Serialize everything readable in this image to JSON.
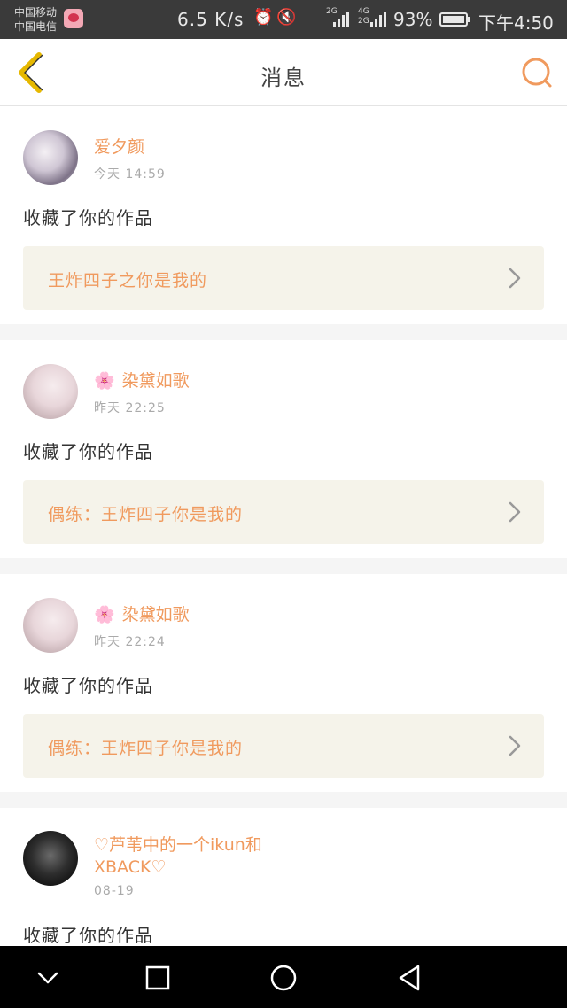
{
  "status_bar": {
    "carrier_1": "中国移动",
    "carrier_2": "中国电信",
    "net_speed": "6.5 K/s",
    "net_label_a1": "2G",
    "net_label_b1": "4G",
    "net_label_b2": "2G",
    "battery": "93%",
    "time": "下午4:50",
    "icons": [
      "alarm-icon",
      "mute-icon",
      "wifi-icon",
      "signal-icon",
      "battery-icon"
    ]
  },
  "header": {
    "title": "消息",
    "back_icon": "chevron-left-icon",
    "search_icon": "search-icon"
  },
  "messages": [
    {
      "user": "爱夕颜",
      "flower": "",
      "time": "今天  14:59",
      "action": "收藏了你的作品",
      "work": "王炸四子之你是我的"
    },
    {
      "user": "染黛如歌",
      "flower": "🌸",
      "time": "昨天  22:25",
      "action": "收藏了你的作品",
      "work": "偶练：王炸四子你是我的"
    },
    {
      "user": "染黛如歌",
      "flower": "🌸",
      "time": "昨天  22:24",
      "action": "收藏了你的作品",
      "work": "偶练：王炸四子你是我的"
    },
    {
      "user": "♡芦苇中的一个ikun和XBACK♡",
      "flower": "",
      "time": "08-19",
      "action": "收藏了你的作品",
      "work": ""
    }
  ],
  "nav_bar": {
    "back": "nav-down-icon",
    "recents": "square-icon",
    "home": "circle-icon",
    "triangle": "triangle-back-icon"
  },
  "colors": {
    "accent": "#f09a5e",
    "back_arrow": "#e6b800",
    "link_bg": "#f5f3ea"
  }
}
